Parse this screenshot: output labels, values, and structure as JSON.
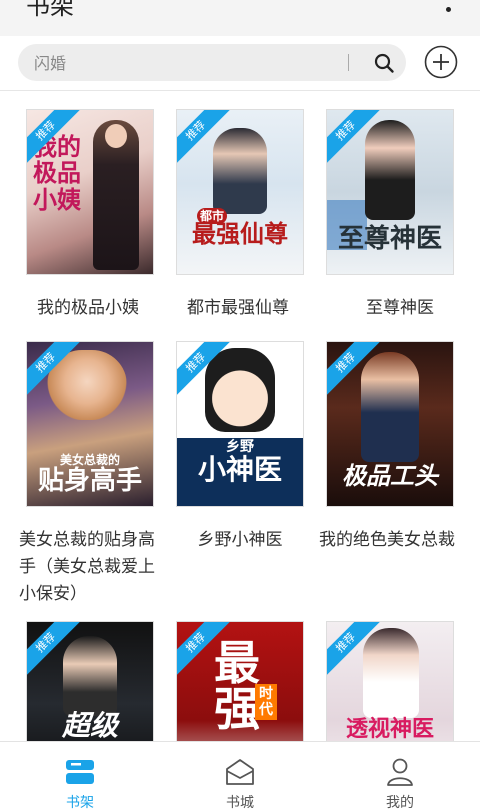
{
  "header": {
    "title": "书架",
    "more_icon": "more-vertical-icon"
  },
  "search": {
    "placeholder": "闪婚",
    "icon": "search-icon",
    "add_icon": "plus-circle-icon"
  },
  "books": [
    {
      "title": "我的极品小姨",
      "badge": "推荐",
      "cover_text": "我的极品小姨"
    },
    {
      "title": "都市最强仙尊",
      "badge": "推荐",
      "cover_text": "最强仙尊",
      "cover_sub": "都市"
    },
    {
      "title": "至尊神医",
      "badge": "推荐",
      "cover_text": "至尊神医"
    },
    {
      "title": "美女总裁的贴身高手（美女总裁爱上小保安）",
      "badge": "推荐",
      "cover_text": "贴身高手",
      "cover_sub": "美女总裁的"
    },
    {
      "title": "乡野小神医",
      "badge": "推荐",
      "cover_text": "小神医",
      "cover_sub": "乡野"
    },
    {
      "title": "我的绝色美女总裁",
      "badge": "推荐",
      "cover_text": "极品工头"
    },
    {
      "title": "",
      "badge": "推荐",
      "cover_text": "超级"
    },
    {
      "title": "",
      "badge": "推荐",
      "cover_text": "最强",
      "cover_sub": "时代"
    },
    {
      "title": "",
      "badge": "推荐",
      "cover_text": "透视神医"
    }
  ],
  "tabs": [
    {
      "label": "书架",
      "icon": "bookshelf-icon",
      "active": true
    },
    {
      "label": "书城",
      "icon": "store-icon",
      "active": false
    },
    {
      "label": "我的",
      "icon": "user-icon",
      "active": false
    }
  ],
  "colors": {
    "accent": "#1aa3e8",
    "tab_inactive": "#555555",
    "badge": "#1aa3e8"
  }
}
